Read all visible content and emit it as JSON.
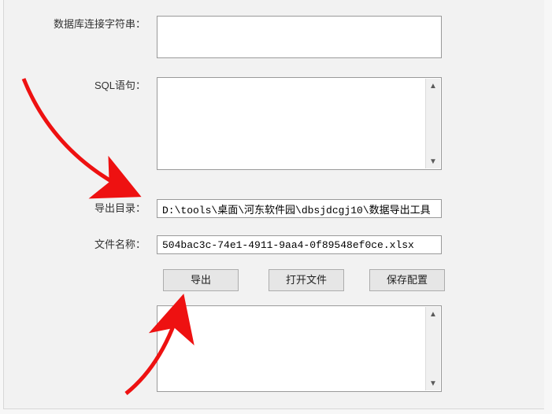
{
  "labels": {
    "conn": "数据库连接字符串：",
    "sql": "SQL语句：",
    "outdir": "导出目录：",
    "fname": "文件名称："
  },
  "fields": {
    "conn_value": "",
    "sql_value": "",
    "outdir_value": "D:\\tools\\桌面\\河东软件园\\dbsjdcgj10\\数据导出工具",
    "fname_value": "504bac3c-74e1-4911-9aa4-0f89548ef0ce.xlsx",
    "log_value": ""
  },
  "buttons": {
    "export": "导出",
    "openfile": "打开文件",
    "saveconf": "保存配置"
  },
  "icons": {
    "up": "▲",
    "down": "▼"
  }
}
